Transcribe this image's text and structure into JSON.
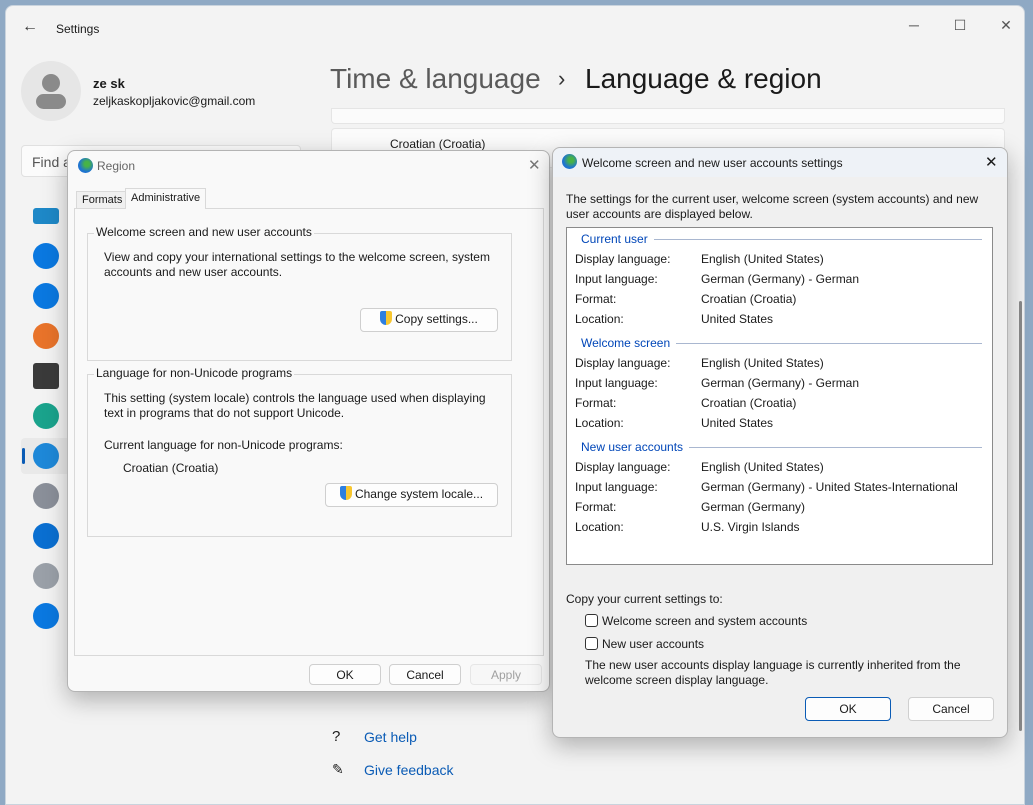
{
  "settings": {
    "title": "Settings",
    "user": {
      "name": "ze sk",
      "email": "zeljkaskopljakovic@gmail.com"
    },
    "search_placeholder": "Find a",
    "breadcrumb": {
      "parent": "Time & language",
      "separator": "›",
      "current": "Language & region"
    },
    "partial_row_text": "Croatian (Croatia)",
    "sidebar_icons": [
      "system-icon",
      "bluetooth-icon",
      "network-icon",
      "personalization-icon",
      "apps-icon",
      "accounts-icon",
      "time-language-icon",
      "gaming-icon",
      "accessibility-icon",
      "privacy-icon",
      "windows-update-icon"
    ],
    "selected_index": 6,
    "footer": {
      "help": "Get help",
      "feedback": "Give feedback"
    }
  },
  "region": {
    "title": "Region",
    "tabs": [
      "Formats",
      "Administrative"
    ],
    "active_tab": "Administrative",
    "welcome_group": {
      "title": "Welcome screen and new user accounts",
      "text": "View and copy your international settings to the welcome screen, system accounts and new user accounts.",
      "button": "Copy settings..."
    },
    "unicode_group": {
      "title": "Language for non-Unicode programs",
      "text": "This setting (system locale) controls the language used when displaying text in programs that do not support Unicode.",
      "current_label": "Current language for non-Unicode programs:",
      "current_value": "Croatian (Croatia)",
      "button": "Change system locale..."
    },
    "buttons": {
      "ok": "OK",
      "cancel": "Cancel",
      "apply": "Apply"
    }
  },
  "welcome": {
    "title": "Welcome screen and new user accounts settings",
    "intro": "The settings for the current user, welcome screen (system accounts) and new user accounts are displayed below.",
    "sections": [
      {
        "title": "Current user",
        "rows": [
          [
            "Display language:",
            "English (United States)"
          ],
          [
            "Input language:",
            "German (Germany) - German"
          ],
          [
            "Format:",
            "Croatian (Croatia)"
          ],
          [
            "Location:",
            "United States"
          ]
        ]
      },
      {
        "title": "Welcome screen",
        "rows": [
          [
            "Display language:",
            "English (United States)"
          ],
          [
            "Input language:",
            "German (Germany) - German"
          ],
          [
            "Format:",
            "Croatian (Croatia)"
          ],
          [
            "Location:",
            "United States"
          ]
        ]
      },
      {
        "title": "New user accounts",
        "rows": [
          [
            "Display language:",
            "English (United States)"
          ],
          [
            "Input language:",
            "German (Germany) - United States-International"
          ],
          [
            "Format:",
            "German (Germany)"
          ],
          [
            "Location:",
            "U.S. Virgin Islands"
          ]
        ]
      }
    ],
    "copy_label": "Copy your current settings to:",
    "checkboxes": [
      {
        "label": "Welcome screen and system accounts",
        "checked": false
      },
      {
        "label": "New user accounts",
        "checked": false
      }
    ],
    "note": "The new user accounts display language is currently inherited from the welcome screen display language.",
    "buttons": {
      "ok": "OK",
      "cancel": "Cancel"
    }
  }
}
